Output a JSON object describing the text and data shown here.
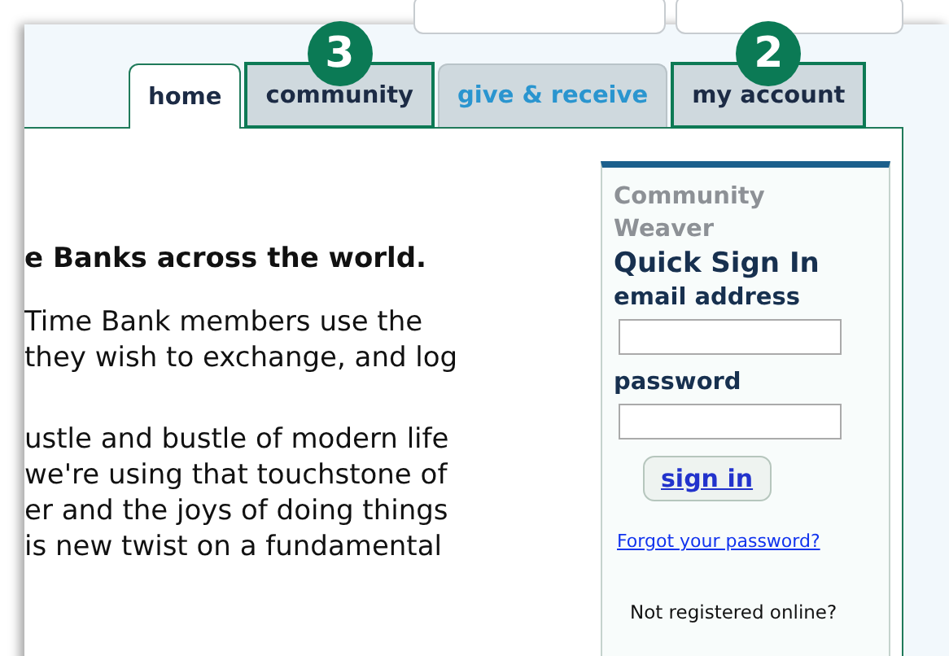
{
  "top_buttons": [
    {
      "kind": "blank"
    },
    {
      "kind": "blank"
    }
  ],
  "tabs": [
    {
      "label": "home",
      "selected": true,
      "color": "#1c2b45"
    },
    {
      "label": "community",
      "selected": false,
      "color": "#1c2b45",
      "callout": "3"
    },
    {
      "label": "give & receive",
      "selected": false,
      "color": "#2a95cf"
    },
    {
      "label": "my account",
      "selected": false,
      "color": "#1c2b45",
      "callout": "2"
    }
  ],
  "main": {
    "heading": "e Banks across the world.",
    "paragraphs": [
      [
        "Time Bank members use the",
        "they wish to exchange, and log"
      ],
      [
        "ustle and bustle of modern life",
        "we're using that touchstone of",
        "er and the joys of doing things",
        "is new twist on a fundamental"
      ]
    ]
  },
  "sign_in": {
    "brand": [
      "Community",
      "Weaver"
    ],
    "title": "Quick Sign In",
    "fields": [
      {
        "label": "email address"
      },
      {
        "label": "password"
      }
    ],
    "button": "sign in",
    "forgot_link": "Forgot your password?",
    "register_text": "Not registered online?"
  }
}
